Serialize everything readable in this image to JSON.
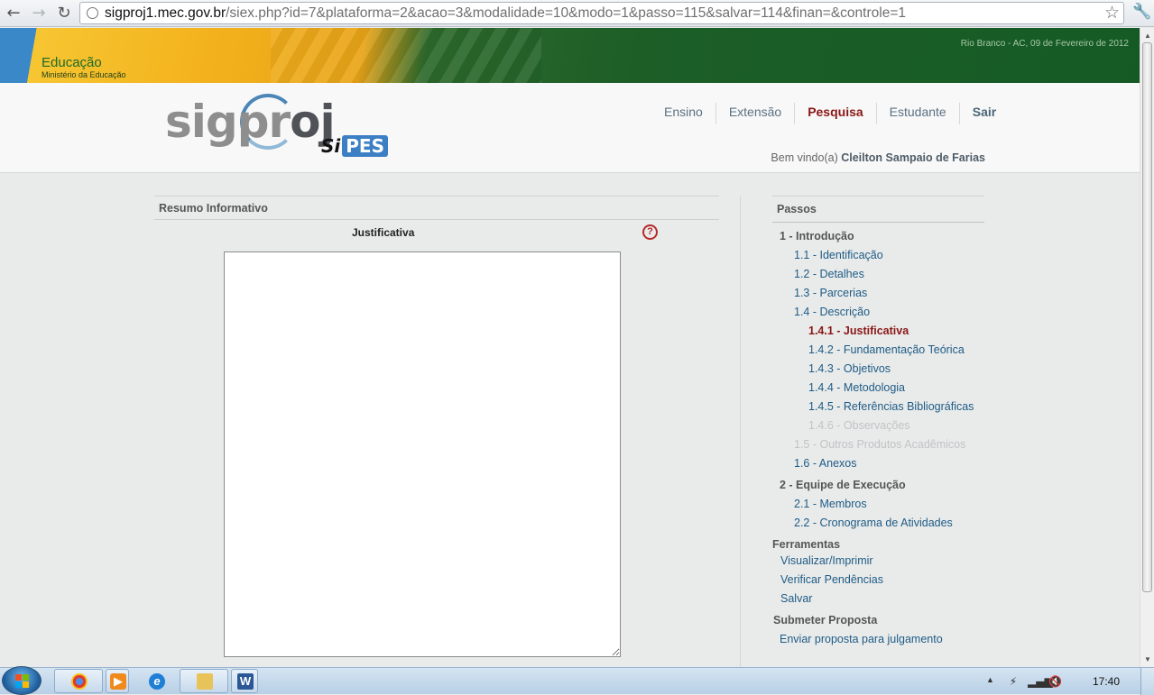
{
  "browser": {
    "url_host": "sigproj1.mec.gov.br",
    "url_path": "/siex.php?id=7&plataforma=2&acao=3&modalidade=10&modo=1&passo=115&salvar=114&finan=&controle=1"
  },
  "gov_banner": {
    "title": "Educação",
    "subtitle": "Ministério da Educação",
    "date": "Rio Branco - AC, 09 de Fevereiro de 2012"
  },
  "header": {
    "logo_text_1": "sigpr",
    "logo_text_2": "oj",
    "logo_sub_1": "Si",
    "logo_sub_2": "PES",
    "nav": [
      "Ensino",
      "Extensão",
      "Pesquisa",
      "Estudante",
      "Sair"
    ],
    "welcome_prefix": "Bem vindo(a)",
    "user_name": "Cleilton Sampaio de Farias"
  },
  "main": {
    "section_title": "Resumo Informativo",
    "field_label": "Justificativa",
    "help_symbol": "?",
    "textarea_value": ""
  },
  "sidebar": {
    "title": "Passos",
    "steps": [
      {
        "label": "1 - Introdução",
        "kind": "group"
      },
      {
        "label": "1.1 - Identificação",
        "kind": "link"
      },
      {
        "label": "1.2 - Detalhes",
        "kind": "link"
      },
      {
        "label": "1.3 - Parcerias",
        "kind": "link"
      },
      {
        "label": "1.4 - Descrição",
        "kind": "link"
      },
      {
        "label": "1.4.1 - Justificativa",
        "kind": "current"
      },
      {
        "label": "1.4.2 - Fundamentação Teórica",
        "kind": "link"
      },
      {
        "label": "1.4.3 - Objetivos",
        "kind": "link"
      },
      {
        "label": "1.4.4 - Metodologia",
        "kind": "link"
      },
      {
        "label": "1.4.5 - Referências Bibliográficas",
        "kind": "link"
      },
      {
        "label": "1.4.6 - Observações",
        "kind": "disabled"
      },
      {
        "label": "1.5 - Outros Produtos Acadêmicos",
        "kind": "disabled"
      },
      {
        "label": "1.6 - Anexos",
        "kind": "link"
      },
      {
        "label": "2 - Equipe de Execução",
        "kind": "group"
      },
      {
        "label": "2.1 - Membros",
        "kind": "link"
      },
      {
        "label": "2.2 - Cronograma de Atividades",
        "kind": "link"
      }
    ],
    "tools_title": "Ferramentas",
    "tools": [
      "Visualizar/Imprimir",
      "Verificar Pendências",
      "Salvar"
    ],
    "submit_title": "Submeter Proposta",
    "submit_link": "Enviar proposta para julgamento"
  },
  "taskbar": {
    "clock": "17:40",
    "apps": [
      "chrome-icon",
      "media-player-icon",
      "internet-explorer-icon",
      "folder-icon",
      "word-icon"
    ]
  },
  "colors": {
    "active_nav": "#8a1717",
    "link": "#1e5b86",
    "disabled": "#c0c4c6",
    "banner_green": "#155a25",
    "banner_yellow": "#f3b21d"
  }
}
